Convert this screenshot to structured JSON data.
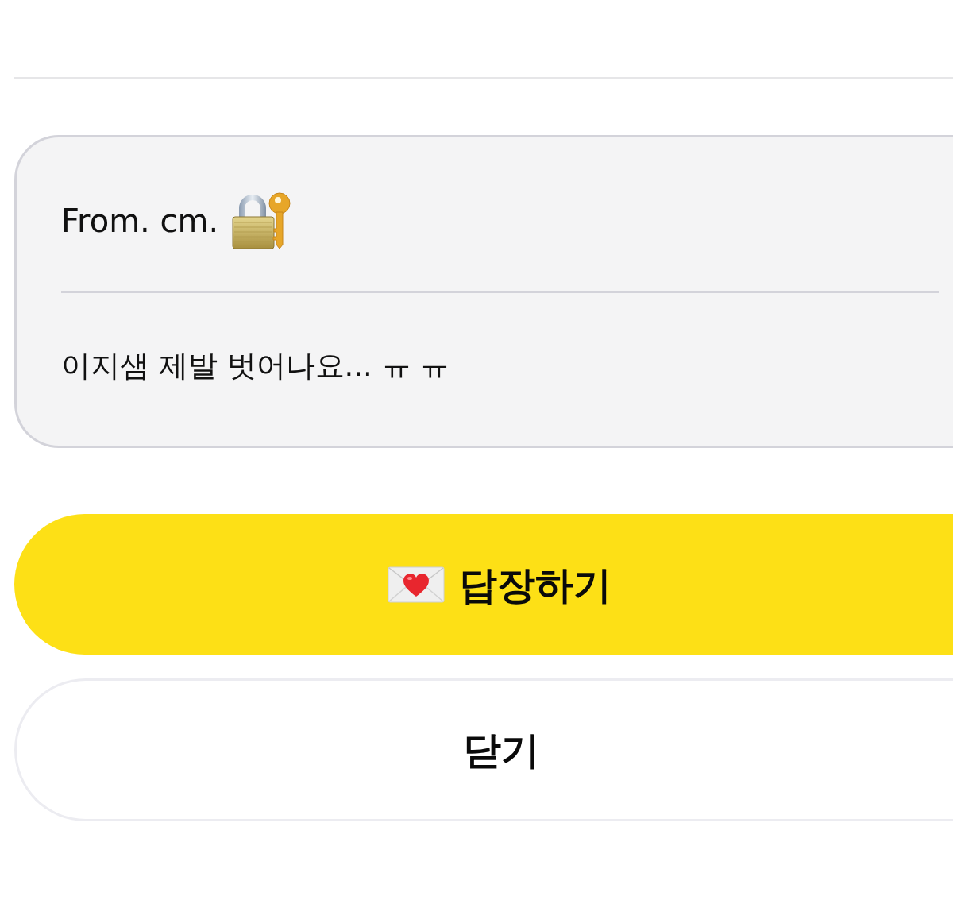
{
  "message_card": {
    "sender": "From. cm.",
    "body": "이지샘 제발 벗어나요... ㅠ ㅠ"
  },
  "buttons": [
    {
      "kind": "primary",
      "label": "답장하기"
    },
    {
      "kind": "secondary",
      "label": "닫기"
    }
  ]
}
